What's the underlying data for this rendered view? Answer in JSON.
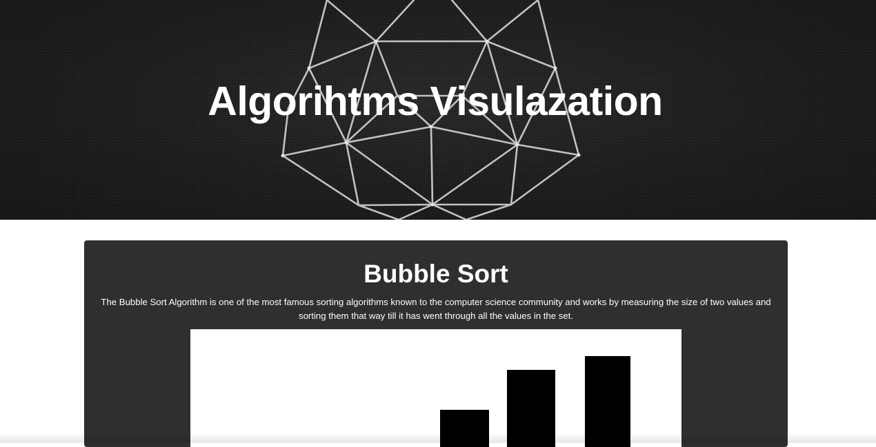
{
  "header": {
    "title": "Algorihtms Visulazation"
  },
  "section": {
    "title": "Bubble Sort",
    "description": "The Bubble Sort Algorithm is one of the most famous sorting algorithms known to the computer science community and works by measuring the size of two values and sorting them that way till it has went through all the values in the set."
  },
  "chart_data": {
    "type": "bar",
    "values": [
      54,
      112,
      132
    ],
    "bar_color": "#000000",
    "background": "#ffffff"
  },
  "colors": {
    "hero_background": "#1a1b1b",
    "card_background": "#2f2f2f",
    "text": "#ffffff",
    "bar": "#000000"
  }
}
